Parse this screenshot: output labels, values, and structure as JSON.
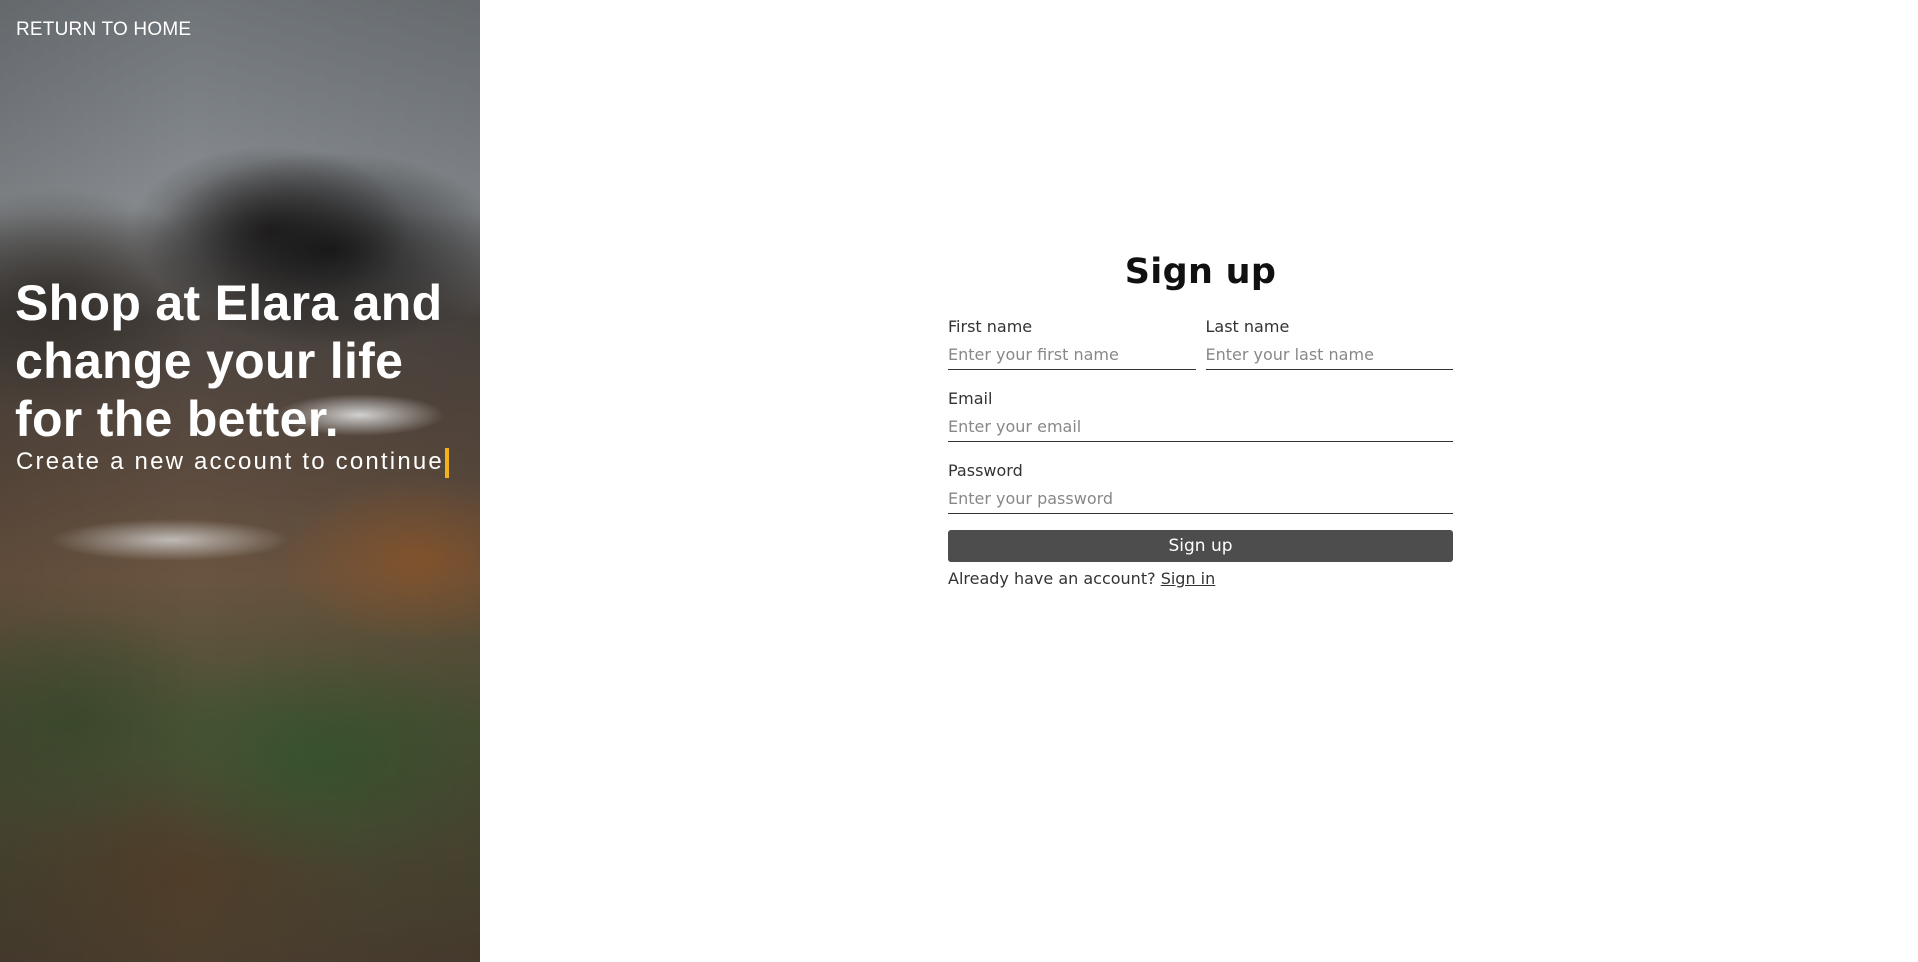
{
  "hero": {
    "return_link": "RETURN TO HOME",
    "title": "Shop at Elara and change your life for the better.",
    "subtitle": "Create a new account to continue.",
    "caret_color": "#f2b21b"
  },
  "form": {
    "title": "Sign up",
    "first_name": {
      "label": "First name",
      "placeholder": "Enter your first name",
      "value": ""
    },
    "last_name": {
      "label": "Last name",
      "placeholder": "Enter your last name",
      "value": ""
    },
    "email": {
      "label": "Email",
      "placeholder": "Enter your email",
      "value": ""
    },
    "password": {
      "label": "Password",
      "placeholder": "Enter your password",
      "value": ""
    },
    "submit_label": "Sign up",
    "already_text": "Already have an account?",
    "sign_in_link": "Sign in",
    "button_color": "#4d4d4d"
  }
}
